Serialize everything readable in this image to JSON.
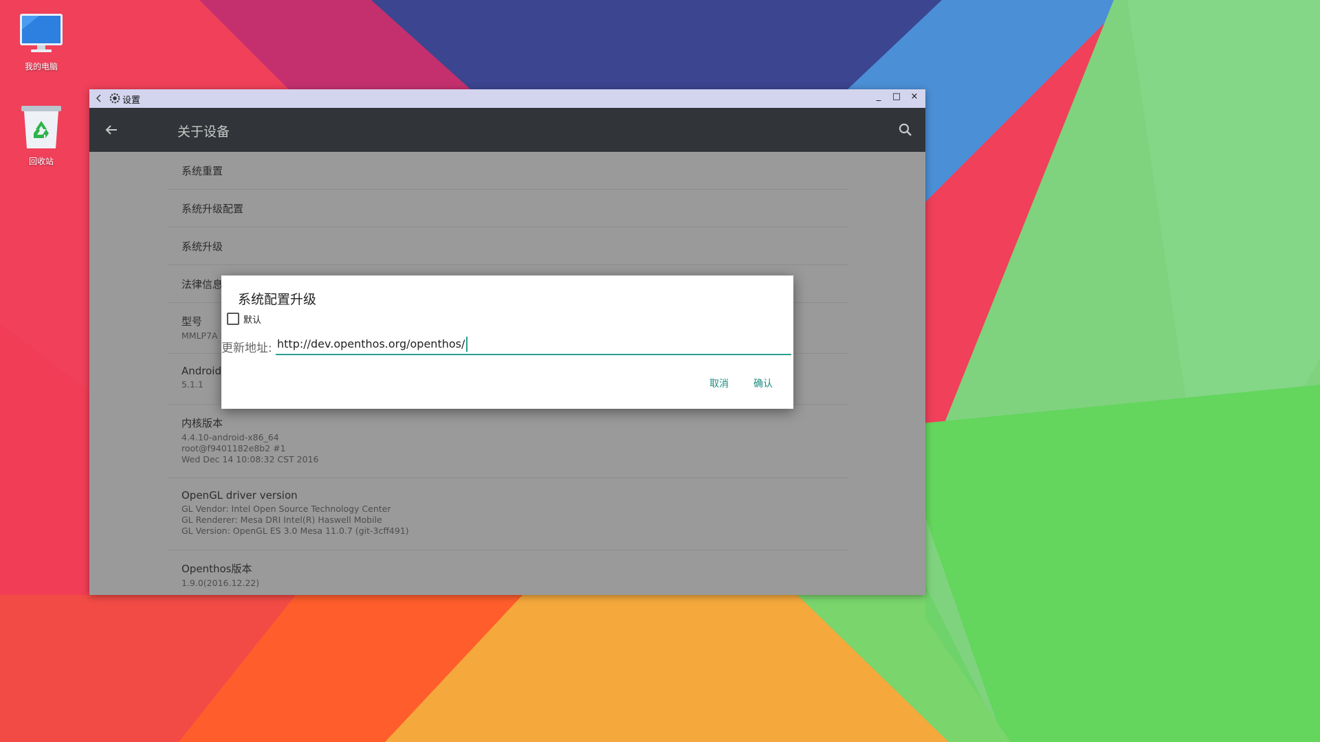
{
  "desktop": {
    "icons": [
      {
        "label": "我的电脑",
        "icon": "computer-icon"
      },
      {
        "label": "回收站",
        "icon": "recycle-bin-icon"
      }
    ],
    "wallpaper_colors": [
      "#ef3b55",
      "#c0316f",
      "#3b448e",
      "#3f89d3",
      "#7fd37d",
      "#f6a72e",
      "#ff5a2b"
    ]
  },
  "window": {
    "title": "设置",
    "icons": {
      "back": "back-icon",
      "app": "gear-icon",
      "minimize": "minimize-icon",
      "maximize": "maximize-icon",
      "close": "close-icon"
    },
    "controls": {
      "minimize": "_",
      "maximize": "□",
      "close": "×"
    }
  },
  "appbar": {
    "title": "关于设备",
    "icons": {
      "back": "arrow-back-icon",
      "search": "search-icon"
    }
  },
  "settings_list": [
    {
      "title": "系统重置",
      "lines": []
    },
    {
      "title": "系统升级配置",
      "lines": []
    },
    {
      "title": "系统升级",
      "lines": []
    },
    {
      "title": "法律信息",
      "lines": []
    },
    {
      "title": "型号",
      "lines": [
        "MMLP7A"
      ]
    },
    {
      "title": "Android",
      "lines": [
        "5.1.1"
      ]
    },
    {
      "title": "内核版本",
      "lines": [
        "4.4.10-android-x86_64",
        "root@f9401182e8b2 #1",
        "Wed Dec 14 10:08:32 CST 2016"
      ]
    },
    {
      "title": "OpenGL driver version",
      "lines": [
        "GL Vendor: Intel Open Source Technology Center",
        "GL Renderer: Mesa DRI Intel(R) Haswell Mobile",
        "GL Version: OpenGL ES 3.0 Mesa 11.0.7 (git-3cff491)"
      ]
    },
    {
      "title": "Openthos版本",
      "lines": [
        "1.9.0(2016.12.22)"
      ]
    }
  ],
  "dialog": {
    "title": "系统配置升级",
    "checkbox_label": "默认",
    "checkbox_checked": false,
    "url_label": "更新地址:",
    "url_value": "http://dev.openthos.org/openthos/",
    "cancel_label": "取消",
    "confirm_label": "确认",
    "accent_color": "#2a9d91"
  }
}
